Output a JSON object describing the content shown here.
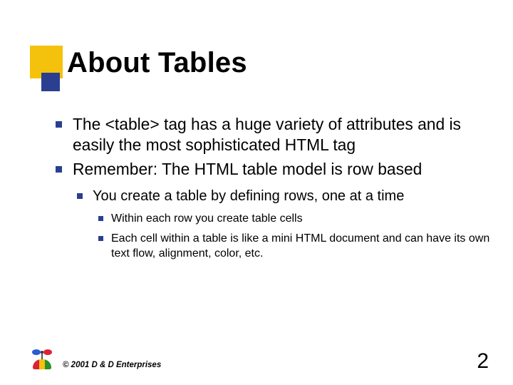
{
  "title": "About Tables",
  "bullets": {
    "b1": "The <table> tag has a huge variety of attributes and is easily the most sophisticated HTML tag",
    "b2": "Remember: The HTML table model is row based",
    "b2_1": "You create a table by defining rows, one at a time",
    "b2_1_a": "Within each row you create table cells",
    "b2_1_b": "Each cell within a table is like a mini HTML document and can have its own text flow, alignment, color, etc."
  },
  "footer": {
    "copyright": "© 2001 D & D Enterprises",
    "page": "2"
  }
}
